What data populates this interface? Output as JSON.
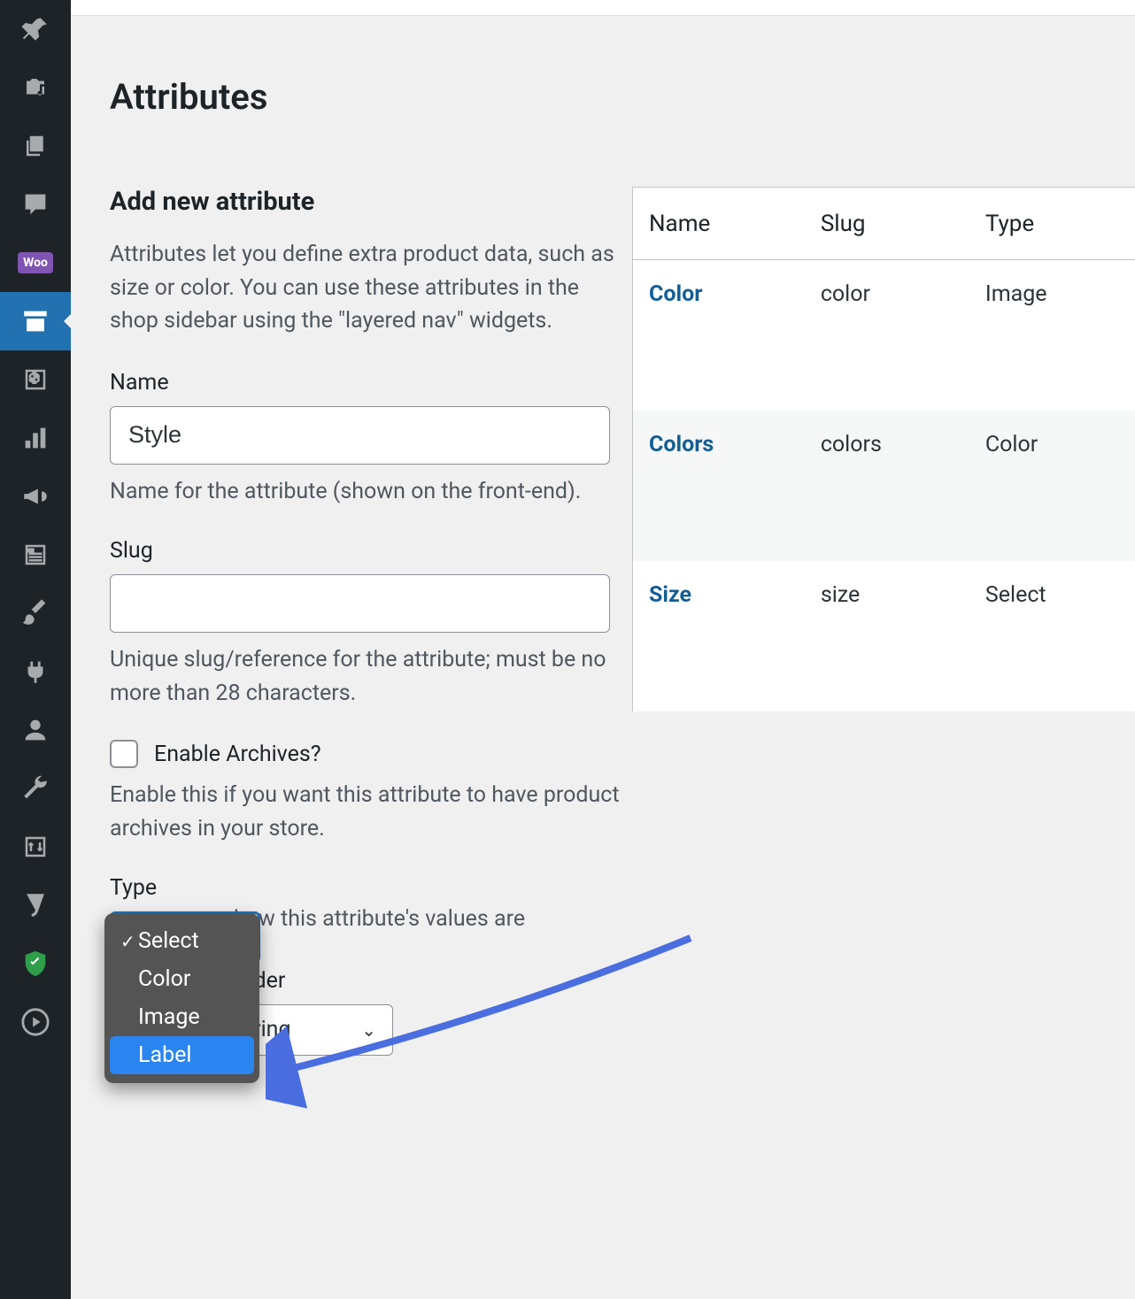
{
  "page": {
    "title": "Attributes"
  },
  "form": {
    "section_title": "Add new attribute",
    "section_desc": "Attributes let you define extra product data, such as size or color. You can use these attributes in the shop sidebar using the \"layered nav\" widgets.",
    "name": {
      "label": "Name",
      "value": "Style",
      "help": "Name for the attribute (shown on the front-end)."
    },
    "slug": {
      "label": "Slug",
      "value": "",
      "help": "Unique slug/reference for the attribute; must be no more than 28 characters."
    },
    "archives": {
      "label": "Enable Archives?",
      "help": "Enable this if you want this attribute to have product archives in your store."
    },
    "type": {
      "label": "Type",
      "help": "how this attribute's values are",
      "options": [
        "Select",
        "Color",
        "Image",
        "Label"
      ],
      "checked": "Select",
      "highlighted": "Label"
    },
    "order": {
      "label": "order",
      "value": "Custom ordering"
    }
  },
  "table": {
    "headers": [
      "Name",
      "Slug",
      "Type"
    ],
    "rows": [
      {
        "name": "Color",
        "slug": "color",
        "type": "Image"
      },
      {
        "name": "Colors",
        "slug": "colors",
        "type": "Color"
      },
      {
        "name": "Size",
        "slug": "size",
        "type": "Select"
      }
    ]
  }
}
